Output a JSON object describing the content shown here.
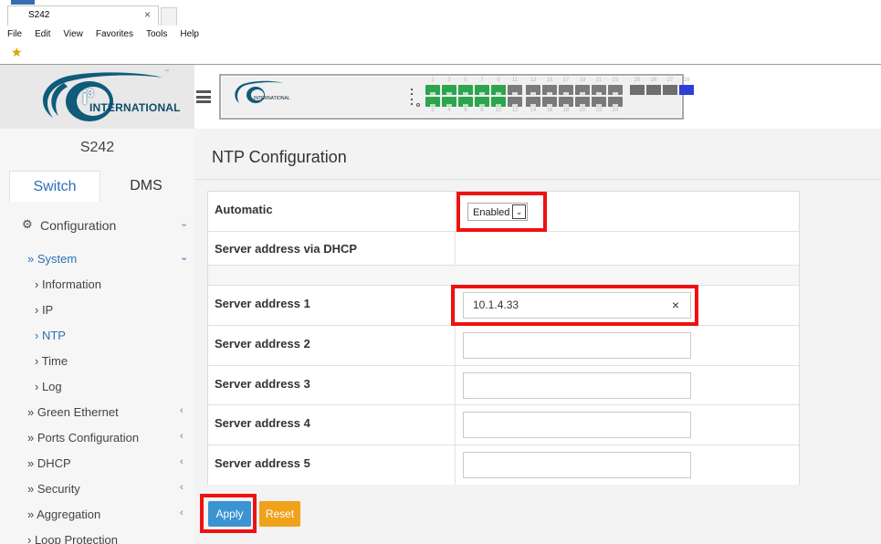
{
  "browser": {
    "tab_title": "S242",
    "tab_close": "×",
    "menu": [
      "File",
      "Edit",
      "View",
      "Favorites",
      "Tools",
      "Help"
    ]
  },
  "header": {
    "logo_superscript": "3",
    "logo_i": "i",
    "logo_text": "INTERNATIONAL",
    "logo_tm": "™",
    "panel_logo_text": "INTERNATIONAL",
    "port_numbers_top": [
      "1",
      "3",
      "5",
      "7",
      "9",
      "11",
      "13",
      "15",
      "17",
      "19",
      "21",
      "23",
      "25",
      "26",
      "27",
      "28"
    ],
    "port_numbers_bottom": [
      "2",
      "4",
      "6",
      "8",
      "10",
      "12",
      "14",
      "16",
      "18",
      "20",
      "22",
      "24"
    ],
    "ports_up": [
      1,
      2,
      3,
      4,
      5,
      6,
      7,
      8,
      9,
      10
    ],
    "sfp_up": [
      28
    ]
  },
  "sidebar": {
    "device_name": "S242",
    "tabs": {
      "switch": "Switch",
      "dms": "DMS"
    },
    "items": [
      {
        "label": "Configuration",
        "prefix": "⚙",
        "chev": "⌄"
      },
      {
        "label": "» System",
        "chev": "⌄"
      },
      {
        "label": "› Information"
      },
      {
        "label": "› IP"
      },
      {
        "label": "› NTP"
      },
      {
        "label": "› Time"
      },
      {
        "label": "› Log"
      },
      {
        "label": "» Green Ethernet",
        "chev": "‹"
      },
      {
        "label": "» Ports Configuration",
        "chev": "‹"
      },
      {
        "label": "» DHCP",
        "chev": "‹"
      },
      {
        "label": "» Security",
        "chev": "‹"
      },
      {
        "label": "» Aggregation",
        "chev": "‹"
      },
      {
        "label": "› Loop Protection"
      }
    ]
  },
  "main": {
    "title": "NTP Configuration",
    "rows": [
      {
        "label": "Automatic"
      },
      {
        "label": "Server address via DHCP"
      },
      {
        "label": "Server address 1"
      },
      {
        "label": "Server address 2"
      },
      {
        "label": "Server address 3"
      },
      {
        "label": "Server address 4"
      },
      {
        "label": "Server address 5"
      }
    ],
    "automatic_value": "Enabled",
    "select_arrow": "⌄",
    "server1_value": "10.1.4.33",
    "clear_icon": "×",
    "apply": "Apply",
    "reset": "Reset"
  },
  "colors": {
    "accent": "#2e6fb7",
    "highlight": "#ee1111",
    "apply": "#3b93d2",
    "reset": "#f0a21a"
  }
}
